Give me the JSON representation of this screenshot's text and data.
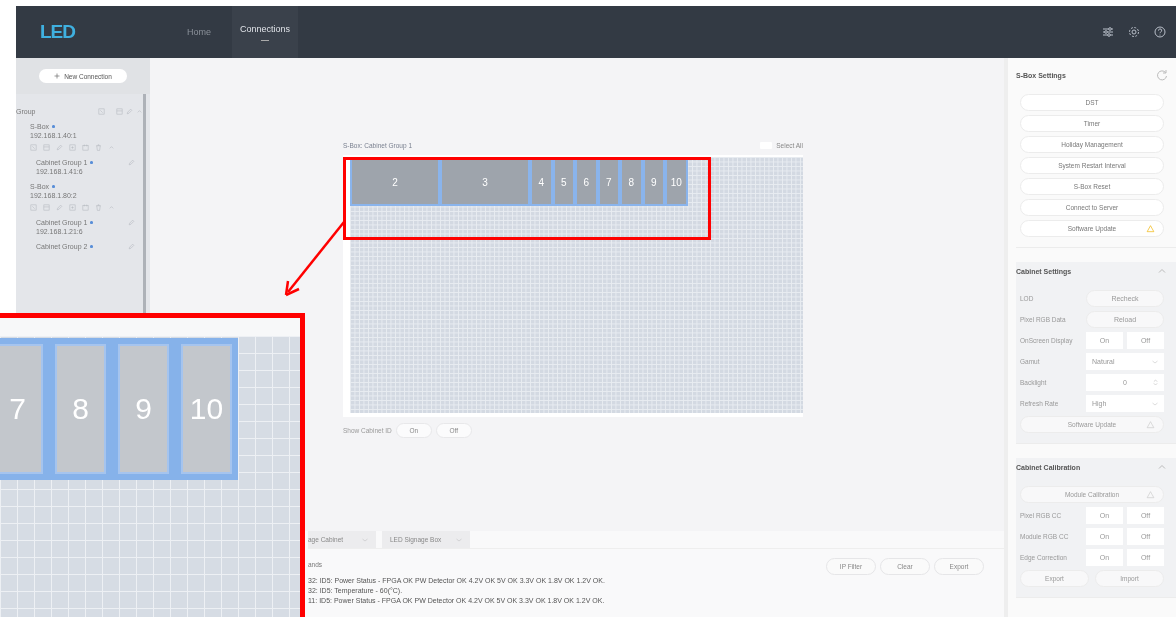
{
  "header": {
    "logo": "LED",
    "nav": [
      {
        "label": "Home",
        "selected": false
      },
      {
        "label": "Connections",
        "selected": true
      }
    ]
  },
  "sidebar": {
    "new_connection": "New Connection",
    "tree": [
      {
        "kind": "group",
        "label": "Group",
        "children": [
          {
            "kind": "sbox",
            "label": "S-Box",
            "ip": "192.168.1.40:1",
            "children": [
              {
                "kind": "cabinet_group",
                "label": "Cabinet Group 1",
                "ip": "192.168.1.41:6"
              }
            ]
          },
          {
            "kind": "sbox",
            "label": "S-Box",
            "ip": "192.168.1.80:2",
            "children": [
              {
                "kind": "cabinet_group",
                "label": "Cabinet Group 1",
                "ip": "192.168.1.21:6"
              },
              {
                "kind": "cabinet_group",
                "label": "Cabinet Group 2"
              }
            ]
          }
        ]
      }
    ]
  },
  "canvas": {
    "title": "S-Box: Cabinet Group 1",
    "select_all": {
      "label": "Select All",
      "checked": false
    },
    "cabinets": [
      {
        "id": "2",
        "kind": "wide",
        "selected": true
      },
      {
        "id": "3",
        "kind": "wide",
        "selected": true
      },
      {
        "id": "4",
        "kind": "narrow",
        "selected": true
      },
      {
        "id": "5",
        "kind": "narrow",
        "selected": true
      },
      {
        "id": "6",
        "kind": "narrow",
        "selected": true
      },
      {
        "id": "7",
        "kind": "narrow",
        "selected": true
      },
      {
        "id": "8",
        "kind": "narrow",
        "selected": true
      },
      {
        "id": "9",
        "kind": "narrow",
        "selected": true
      },
      {
        "id": "10",
        "kind": "narrow",
        "selected": true
      }
    ],
    "show_cabinet_id": {
      "label": "Show Cabinet ID",
      "options": [
        {
          "label": "On",
          "selected": false
        },
        {
          "label": "Off",
          "selected": false
        }
      ]
    }
  },
  "bottom_panel": {
    "tabs": [
      {
        "label": "age Cabinet",
        "selected": false
      },
      {
        "label": "LED Signage Box",
        "selected": false
      }
    ],
    "log_title": "ands",
    "buttons": [
      "IP Filter",
      "Clear",
      "Export"
    ],
    "log_lines": [
      "32: ID5: Power Status - FPGA OK PW Detector OK 4.2V OK 5V OK 3.3V OK 1.8V OK 1.2V OK.",
      "32: ID5: Temperature - 60(°C).",
      "11: ID5: Power Status - FPGA OK PW Detector OK 4.2V OK 5V OK 3.3V OK 1.8V OK 1.2V OK."
    ]
  },
  "right_panel": {
    "sections": [
      {
        "title": "S-Box Settings",
        "disabled": false,
        "rows": [
          {
            "kind": "wide_button",
            "label": "DST",
            "warning": false
          },
          {
            "kind": "wide_button",
            "label": "Timer",
            "warning": false
          },
          {
            "kind": "wide_button",
            "label": "Holiday Management",
            "warning": false
          },
          {
            "kind": "wide_button",
            "label": "System Restart Interval",
            "warning": false
          },
          {
            "kind": "wide_button",
            "label": "S-Box Reset",
            "warning": false
          },
          {
            "kind": "wide_button",
            "label": "Connect to Server",
            "warning": false
          },
          {
            "kind": "wide_button",
            "label": "Software Update",
            "warning": true
          }
        ]
      },
      {
        "title": "Cabinet Settings",
        "expanded": true,
        "disabled": true,
        "rows": [
          {
            "kind": "button",
            "label": "LOD",
            "button": "Recheck"
          },
          {
            "kind": "button",
            "label": "Pixel RGB Data",
            "button": "Reload"
          },
          {
            "kind": "toggle",
            "label": "OnScreen Display",
            "options": [
              "On",
              "Off"
            ]
          },
          {
            "kind": "select",
            "label": "Gamut",
            "value": "Natural"
          },
          {
            "kind": "number",
            "label": "Backlight",
            "value": "0"
          },
          {
            "kind": "select",
            "label": "Refresh Rate",
            "value": "High"
          },
          {
            "kind": "wide_button",
            "label": "Software Update",
            "warning": true
          }
        ]
      },
      {
        "title": "Cabinet Calibration",
        "expanded": true,
        "disabled": true,
        "rows": [
          {
            "kind": "wide_button",
            "label": "Module Calibration",
            "warning": true
          },
          {
            "kind": "toggle",
            "label": "Pixel RGB CC",
            "options": [
              "On",
              "Off"
            ]
          },
          {
            "kind": "toggle",
            "label": "Module RGB CC",
            "options": [
              "On",
              "Off"
            ]
          },
          {
            "kind": "toggle",
            "label": "Edge Correction",
            "options": [
              "On",
              "Off"
            ]
          },
          {
            "kind": "pair",
            "buttons": [
              "Export",
              "Import"
            ]
          }
        ]
      }
    ]
  },
  "annotation": {
    "inset_cabinets": [
      "7",
      "8",
      "9",
      "10"
    ]
  }
}
